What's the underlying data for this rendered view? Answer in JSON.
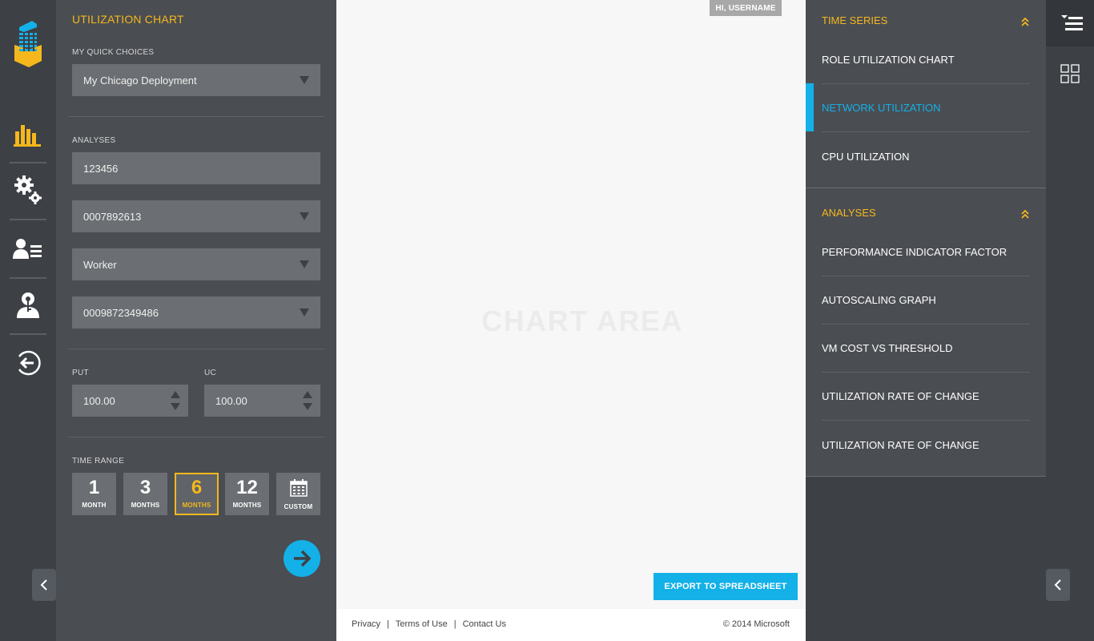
{
  "brand": {
    "accent": "#f5b81c",
    "highlight": "#13b1e8",
    "rail_bg": "#3d4045",
    "panel_bg": "#4a4d52",
    "field_bg": "#6b6e72"
  },
  "left_rail": {
    "icons": [
      "logo-icon",
      "bar-chart-icon",
      "settings-gears-icon",
      "user-list-icon",
      "user-lock-icon",
      "signout-icon"
    ]
  },
  "form": {
    "title": "UTILIZATION CHART",
    "quick_choices_label": "MY QUICK CHOICES",
    "quick_choice_value": "My Chicago Deployment",
    "analyses_label": "ANALYSES",
    "analysis_id": "123456",
    "select_1": "0007892613",
    "select_2": "Worker",
    "select_3": "0009872349486",
    "put_label": "PUT",
    "put_value": "100.00",
    "uc_label": "UC",
    "uc_value": "100.00",
    "time_range_label": "TIME RANGE",
    "time_range": [
      {
        "n": "1",
        "unit": "MONTH"
      },
      {
        "n": "3",
        "unit": "MONTHS"
      },
      {
        "n": "6",
        "unit": "MONTHS"
      },
      {
        "n": "12",
        "unit": "MONTHS"
      },
      {
        "n": "",
        "unit": "CUSTOM"
      }
    ],
    "time_range_selected": "6"
  },
  "center": {
    "user_badge": "HI, USERNAME",
    "chart_placeholder": "CHART AREA",
    "export_label": "EXPORT TO SPREADSHEET"
  },
  "footer": {
    "privacy": "Privacy",
    "terms": "Terms of Use",
    "contact": "Contact Us",
    "separator": "|",
    "copyright": "© 2014 Microsoft"
  },
  "right_panel": {
    "time_series_title": "TIME SERIES",
    "time_series_items": [
      "ROLE UTILIZATION CHART",
      "NETWORK UTILIZATION",
      "CPU UTILIZATION"
    ],
    "time_series_active": "NETWORK UTILIZATION",
    "analyses_title": "ANALYSES",
    "analyses_items": [
      "PERFORMANCE INDICATOR FACTOR",
      "AUTOSCALING GRAPH",
      "VM COST VS THRESHOLD",
      "UTILIZATION RATE OF CHANGE",
      "UTILIZATION RATE OF CHANGE"
    ]
  }
}
